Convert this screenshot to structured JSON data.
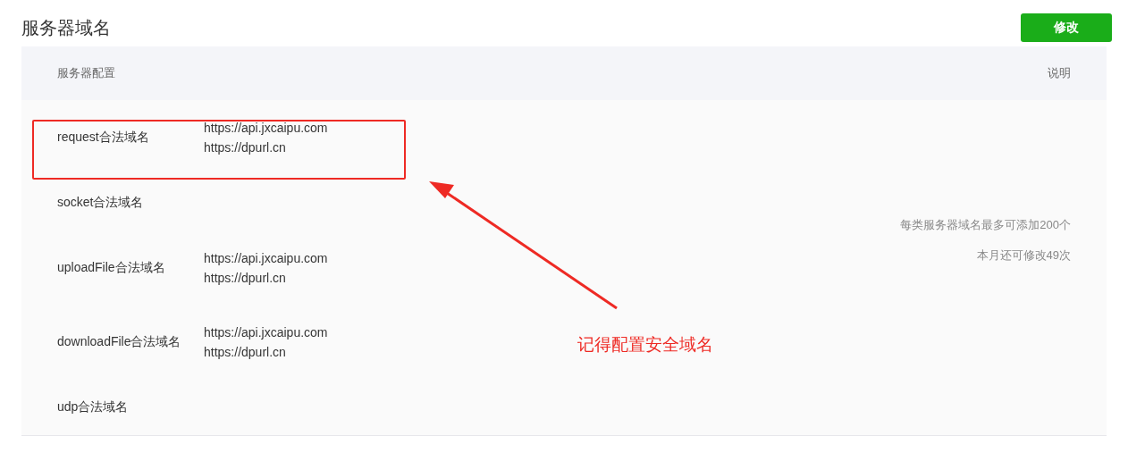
{
  "title": "服务器域名",
  "edit_button": "修改",
  "table": {
    "columns": [
      "服务器配置",
      "说明"
    ],
    "rows": [
      {
        "label": "request合法域名",
        "domains": [
          "https://api.jxcaipu.com",
          "https://dpurl.cn"
        ]
      },
      {
        "label": "socket合法域名",
        "domains": []
      },
      {
        "label": "uploadFile合法域名",
        "domains": [
          "https://api.jxcaipu.com",
          "https://dpurl.cn"
        ]
      },
      {
        "label": "downloadFile合法域名",
        "domains": [
          "https://api.jxcaipu.com",
          "https://dpurl.cn"
        ]
      },
      {
        "label": "udp合法域名",
        "domains": []
      }
    ],
    "notes": [
      "每类服务器域名最多可添加200个",
      "本月还可修改49次"
    ]
  },
  "annotation": {
    "text": "记得配置安全域名"
  }
}
